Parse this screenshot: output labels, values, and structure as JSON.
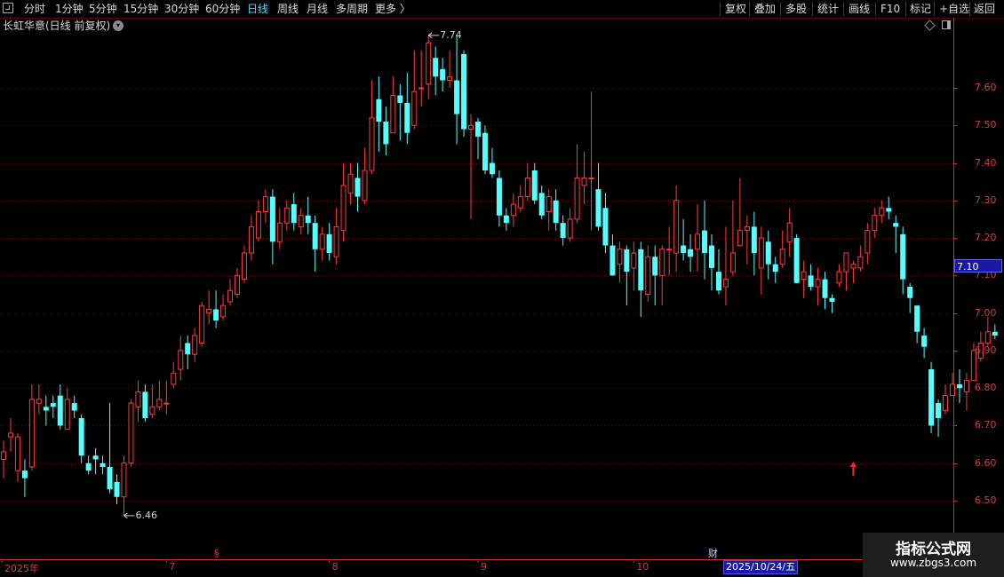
{
  "toolbar": {
    "left": [
      {
        "label": "分时",
        "x": 27
      },
      {
        "label": "1分钟",
        "x": 62
      },
      {
        "label": "5分钟",
        "x": 100
      },
      {
        "label": "15分钟",
        "x": 139
      },
      {
        "label": "30分钟",
        "x": 185
      },
      {
        "label": "60分钟",
        "x": 231
      },
      {
        "label": "日线",
        "x": 278,
        "active": true
      },
      {
        "label": "周线",
        "x": 312
      },
      {
        "label": "月线",
        "x": 345
      },
      {
        "label": "多周期",
        "x": 378
      },
      {
        "label": "更多 〉",
        "x": 422
      }
    ],
    "right": [
      {
        "label": "复权",
        "x": 816
      },
      {
        "label": "叠加",
        "x": 849
      },
      {
        "label": "多股",
        "x": 884
      },
      {
        "label": "统计",
        "x": 920
      },
      {
        "label": "画线",
        "x": 955
      },
      {
        "label": "F10",
        "x": 991
      },
      {
        "label": "标记",
        "x": 1024
      },
      {
        "label": "+自选",
        "x": 1057
      },
      {
        "label": "返回",
        "x": 1096
      }
    ]
  },
  "title": "长虹华意(日线 前复权)",
  "current_price": "7.10",
  "date_box": "2025/10/24/五",
  "badges": {
    "s": "§",
    "cai": "财"
  },
  "watermark": {
    "title": "指标公式网",
    "url": "www.zbgs3.com"
  },
  "colors": {
    "up": "#ff3a3a",
    "down": "#54ffff",
    "grid": "#6a0000",
    "axis": "#c83030",
    "text": "#d04040"
  },
  "chart_data": {
    "type": "candlestick",
    "title": "长虹华意(日线 前复权)",
    "y_ticks": [
      6.5,
      6.6,
      6.7,
      6.8,
      6.9,
      7.0,
      7.1,
      7.2,
      7.3,
      7.4,
      7.5,
      7.6
    ],
    "y_range": [
      6.405,
      7.8
    ],
    "x_labels": [
      {
        "label": "2025年",
        "index": 0
      },
      {
        "label": "7",
        "index": 23
      },
      {
        "label": "8",
        "index": 46
      },
      {
        "label": "9",
        "index": 67
      },
      {
        "label": "10",
        "index": 89
      }
    ],
    "annotations": [
      {
        "label": "7.74",
        "index": 60,
        "price": 7.74
      },
      {
        "label": "6.46",
        "index": 17,
        "price": 6.46
      }
    ],
    "marker_arrow": {
      "index": 120,
      "price": 6.58
    },
    "candles": [
      [
        6.61,
        6.63,
        6.66,
        6.56
      ],
      [
        6.67,
        6.68,
        6.72,
        6.63
      ],
      [
        6.58,
        6.67,
        6.68,
        6.55
      ],
      [
        6.58,
        6.56,
        6.61,
        6.51
      ],
      [
        6.59,
        6.77,
        6.81,
        6.58
      ],
      [
        6.76,
        6.77,
        6.81,
        6.73
      ],
      [
        6.75,
        6.74,
        6.78,
        6.7
      ],
      [
        6.76,
        6.75,
        6.78,
        6.72
      ],
      [
        6.78,
        6.7,
        6.81,
        6.69
      ],
      [
        6.69,
        6.77,
        6.8,
        6.69
      ],
      [
        6.76,
        6.74,
        6.78,
        6.72
      ],
      [
        6.72,
        6.62,
        6.73,
        6.6
      ],
      [
        6.6,
        6.58,
        6.62,
        6.57
      ],
      [
        6.62,
        6.61,
        6.64,
        6.57
      ],
      [
        6.6,
        6.59,
        6.62,
        6.57
      ],
      [
        6.59,
        6.53,
        6.76,
        6.52
      ],
      [
        6.55,
        6.51,
        6.57,
        6.49
      ],
      [
        6.51,
        6.6,
        6.62,
        6.46
      ],
      [
        6.6,
        6.76,
        6.77,
        6.59
      ],
      [
        6.75,
        6.79,
        6.82,
        6.71
      ],
      [
        6.79,
        6.72,
        6.81,
        6.71
      ],
      [
        6.73,
        6.75,
        6.81,
        6.72
      ],
      [
        6.75,
        6.77,
        6.82,
        6.74
      ],
      [
        6.76,
        6.76,
        6.82,
        6.73
      ],
      [
        6.81,
        6.84,
        6.87,
        6.8
      ],
      [
        6.85,
        6.9,
        6.94,
        6.82
      ],
      [
        6.92,
        6.89,
        6.94,
        6.85
      ],
      [
        6.89,
        6.94,
        6.96,
        6.87
      ],
      [
        6.92,
        7.02,
        7.03,
        6.91
      ],
      [
        7.0,
        7.01,
        7.06,
        6.97
      ],
      [
        7.01,
        6.98,
        7.06,
        6.96
      ],
      [
        6.99,
        7.02,
        7.05,
        6.98
      ],
      [
        7.03,
        7.06,
        7.09,
        7.02
      ],
      [
        7.05,
        7.1,
        7.12,
        7.04
      ],
      [
        7.09,
        7.16,
        7.18,
        7.08
      ],
      [
        7.16,
        7.23,
        7.26,
        7.14
      ],
      [
        7.2,
        7.27,
        7.3,
        7.19
      ],
      [
        7.27,
        7.31,
        7.33,
        7.24
      ],
      [
        7.31,
        7.19,
        7.33,
        7.13
      ],
      [
        7.19,
        7.24,
        7.28,
        7.17
      ],
      [
        7.24,
        7.28,
        7.3,
        7.22
      ],
      [
        7.29,
        7.24,
        7.32,
        7.22
      ],
      [
        7.23,
        7.26,
        7.28,
        7.21
      ],
      [
        7.26,
        7.24,
        7.31,
        7.21
      ],
      [
        7.24,
        7.17,
        7.26,
        7.11
      ],
      [
        7.17,
        7.21,
        7.23,
        7.14
      ],
      [
        7.21,
        7.16,
        7.24,
        7.14
      ],
      [
        7.15,
        7.23,
        7.28,
        7.13
      ],
      [
        7.22,
        7.34,
        7.4,
        7.19
      ],
      [
        7.32,
        7.37,
        7.4,
        7.29
      ],
      [
        7.36,
        7.31,
        7.4,
        7.27
      ],
      [
        7.3,
        7.38,
        7.44,
        7.29
      ],
      [
        7.38,
        7.52,
        7.62,
        7.37
      ],
      [
        7.57,
        7.51,
        7.63,
        7.43
      ],
      [
        7.51,
        7.45,
        7.55,
        7.42
      ],
      [
        7.48,
        7.58,
        7.63,
        7.48
      ],
      [
        7.58,
        7.56,
        7.61,
        7.46
      ],
      [
        7.56,
        7.48,
        7.64,
        7.45
      ],
      [
        7.5,
        7.59,
        7.7,
        7.49
      ],
      [
        7.6,
        7.6,
        7.7,
        7.55
      ],
      [
        7.61,
        7.72,
        7.74,
        7.57
      ],
      [
        7.68,
        7.63,
        7.71,
        7.58
      ],
      [
        7.65,
        7.62,
        7.68,
        7.59
      ],
      [
        7.62,
        7.63,
        7.7,
        7.6
      ],
      [
        7.62,
        7.53,
        7.74,
        7.45
      ],
      [
        7.69,
        7.49,
        7.7,
        7.47
      ],
      [
        7.49,
        7.5,
        7.53,
        7.25
      ],
      [
        7.51,
        7.47,
        7.52,
        7.41
      ],
      [
        7.48,
        7.38,
        7.5,
        7.37
      ],
      [
        7.4,
        7.37,
        7.44,
        7.36
      ],
      [
        7.36,
        7.26,
        7.38,
        7.23
      ],
      [
        7.26,
        7.24,
        7.28,
        7.22
      ],
      [
        7.26,
        7.29,
        7.32,
        7.23
      ],
      [
        7.28,
        7.31,
        7.34,
        7.27
      ],
      [
        7.31,
        7.36,
        7.4,
        7.3
      ],
      [
        7.38,
        7.3,
        7.4,
        7.29
      ],
      [
        7.32,
        7.26,
        7.34,
        7.25
      ],
      [
        7.27,
        7.31,
        7.33,
        7.22
      ],
      [
        7.3,
        7.24,
        7.33,
        7.22
      ],
      [
        7.24,
        7.2,
        7.26,
        7.18
      ],
      [
        7.2,
        7.25,
        7.28,
        7.19
      ],
      [
        7.25,
        7.36,
        7.45,
        7.24
      ],
      [
        7.34,
        7.36,
        7.43,
        7.29
      ],
      [
        7.36,
        7.36,
        7.59,
        7.22
      ],
      [
        7.33,
        7.23,
        7.4,
        7.22
      ],
      [
        7.28,
        7.18,
        7.32,
        7.16
      ],
      [
        7.18,
        7.1,
        7.21,
        7.1
      ],
      [
        7.13,
        7.17,
        7.19,
        7.08
      ],
      [
        7.17,
        7.11,
        7.18,
        7.02
      ],
      [
        7.12,
        7.16,
        7.19,
        7.06
      ],
      [
        7.17,
        7.06,
        7.19,
        6.99
      ],
      [
        7.05,
        7.15,
        7.18,
        7.03
      ],
      [
        7.15,
        7.1,
        7.18,
        7.02
      ],
      [
        7.1,
        7.17,
        7.18,
        7.02
      ],
      [
        7.17,
        7.17,
        7.23,
        7.1
      ],
      [
        7.16,
        7.3,
        7.34,
        7.11
      ],
      [
        7.18,
        7.16,
        7.25,
        7.14
      ],
      [
        7.17,
        7.15,
        7.21,
        7.11
      ],
      [
        7.17,
        7.21,
        7.29,
        7.11
      ],
      [
        7.22,
        7.16,
        7.3,
        7.09
      ],
      [
        7.18,
        7.12,
        7.21,
        7.06
      ],
      [
        7.11,
        7.06,
        7.17,
        7.05
      ],
      [
        7.07,
        7.09,
        7.23,
        7.02
      ],
      [
        7.11,
        7.16,
        7.3,
        7.1
      ],
      [
        7.18,
        7.22,
        7.36,
        7.18
      ],
      [
        7.22,
        7.23,
        7.26,
        7.13
      ],
      [
        7.23,
        7.16,
        7.27,
        7.1
      ],
      [
        7.12,
        7.2,
        7.23,
        7.05
      ],
      [
        7.19,
        7.13,
        7.22,
        7.09
      ],
      [
        7.13,
        7.11,
        7.15,
        7.08
      ],
      [
        7.13,
        7.17,
        7.22,
        7.12
      ],
      [
        7.19,
        7.24,
        7.28,
        7.15
      ],
      [
        7.2,
        7.08,
        7.21,
        7.08
      ],
      [
        7.09,
        7.11,
        7.14,
        7.04
      ],
      [
        7.1,
        7.07,
        7.13,
        7.06
      ],
      [
        7.07,
        7.09,
        7.12,
        7.02
      ],
      [
        7.09,
        7.04,
        7.11,
        7.01
      ],
      [
        7.04,
        7.03,
        7.05,
        7.0
      ],
      [
        7.08,
        7.11,
        7.13,
        7.07
      ],
      [
        7.11,
        7.16,
        7.16,
        7.06
      ],
      [
        7.12,
        7.13,
        7.14,
        7.08
      ],
      [
        7.12,
        7.15,
        7.18,
        7.11
      ],
      [
        7.16,
        7.22,
        7.24,
        7.13
      ],
      [
        7.22,
        7.26,
        7.28,
        7.2
      ],
      [
        7.26,
        7.28,
        7.3,
        7.24
      ],
      [
        7.28,
        7.27,
        7.31,
        7.25
      ],
      [
        7.24,
        7.23,
        7.26,
        7.16
      ],
      [
        7.21,
        7.09,
        7.23,
        7.05
      ],
      [
        7.07,
        7.04,
        7.08,
        7.0
      ],
      [
        7.02,
        6.95,
        7.02,
        6.92
      ],
      [
        6.94,
        6.91,
        6.96,
        6.88
      ],
      [
        6.85,
        6.7,
        6.87,
        6.68
      ],
      [
        6.76,
        6.72,
        6.77,
        6.67
      ],
      [
        6.74,
        6.78,
        6.81,
        6.73
      ],
      [
        6.78,
        6.81,
        6.84,
        6.78
      ],
      [
        6.81,
        6.8,
        6.85,
        6.76
      ],
      [
        6.79,
        6.82,
        6.84,
        6.74
      ],
      [
        6.82,
        6.9,
        6.92,
        6.82
      ],
      [
        6.88,
        6.92,
        6.95,
        6.87
      ],
      [
        6.92,
        6.95,
        6.99,
        6.91
      ],
      [
        6.95,
        6.94,
        6.97,
        6.93
      ]
    ]
  }
}
